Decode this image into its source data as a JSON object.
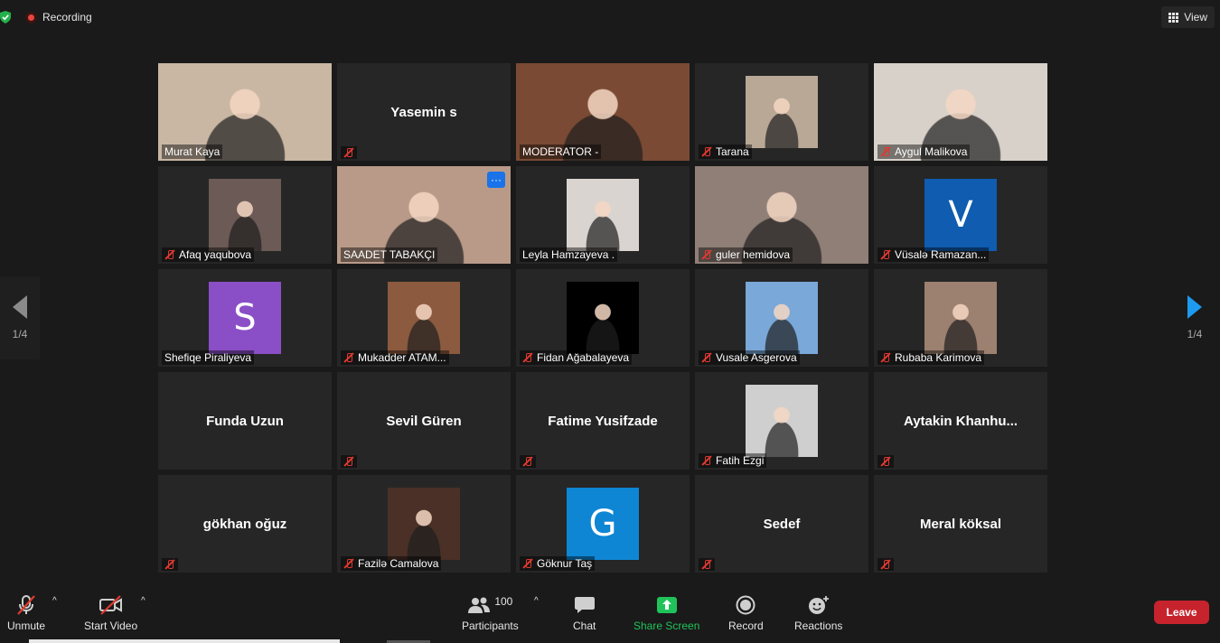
{
  "topbar": {
    "recording_label": "Recording",
    "view_label": "View"
  },
  "pager": {
    "left_label": "1/4",
    "right_label": "1/4"
  },
  "tiles": [
    {
      "name": "Murat Kaya",
      "muted": false,
      "kind": "photo",
      "bg": "#c9b7a4"
    },
    {
      "name": "Yasemin s",
      "muted": true,
      "kind": "name"
    },
    {
      "name": "MODERATOR -",
      "muted": false,
      "kind": "photo",
      "bg": "#7a4a34"
    },
    {
      "name": "Tarana",
      "muted": true,
      "kind": "photo",
      "bg": "#b8a895"
    },
    {
      "name": "Aygul Malikova",
      "muted": true,
      "kind": "photo",
      "bg": "#d7d1c9"
    },
    {
      "name": "Afaq yaqubova",
      "muted": true,
      "kind": "photo",
      "bg": "#6b5a55"
    },
    {
      "name": "SAADET TABAKÇI",
      "muted": false,
      "kind": "photo",
      "bg": "#b99a88",
      "active": true
    },
    {
      "name": "Leyla Hamzayeva .",
      "muted": false,
      "kind": "photo",
      "bg": "#d9d4cf"
    },
    {
      "name": "guler hemidova",
      "muted": true,
      "kind": "photo",
      "bg": "#8f7f77"
    },
    {
      "name": "Vüsalə Ramazan...",
      "muted": true,
      "kind": "letter",
      "letter": "V",
      "color": "#0f5cb0"
    },
    {
      "name": "Shefiqe Piraliyeva",
      "muted": false,
      "kind": "letter",
      "letter": "S",
      "color": "#8a4fc6"
    },
    {
      "name": "Mukadder ATAM...",
      "muted": true,
      "kind": "photo",
      "bg": "#8c5a3e"
    },
    {
      "name": "Fidan Ağabalayeva",
      "muted": true,
      "kind": "photo",
      "bg": "#000000"
    },
    {
      "name": "Vusale Asgerova",
      "muted": true,
      "kind": "photo",
      "bg": "#7aa8d8"
    },
    {
      "name": "Rubaba Karimova",
      "muted": true,
      "kind": "photo",
      "bg": "#9c8070"
    },
    {
      "name": "Funda Uzun",
      "muted": false,
      "kind": "name"
    },
    {
      "name": "Sevil Güren",
      "muted": true,
      "kind": "name"
    },
    {
      "name": "Fatime Yusifzade",
      "muted": true,
      "kind": "name"
    },
    {
      "name": "Fatih Ezgi",
      "muted": true,
      "kind": "photo",
      "bg": "#cfcfcf"
    },
    {
      "name": "Aytakin  Khanhu...",
      "muted": true,
      "kind": "name"
    },
    {
      "name": "gökhan oğuz",
      "muted": true,
      "kind": "name"
    },
    {
      "name": "Fazilə Camalova",
      "muted": true,
      "kind": "photo",
      "bg": "#4a3026"
    },
    {
      "name": "Göknur Taş",
      "muted": true,
      "kind": "letter",
      "letter": "G",
      "color": "#0e86d4"
    },
    {
      "name": "Sedef",
      "muted": true,
      "kind": "name"
    },
    {
      "name": "Meral köksal",
      "muted": true,
      "kind": "name"
    }
  ],
  "toolbar": {
    "unmute": "Unmute",
    "start_video": "Start Video",
    "participants": "Participants",
    "participants_count": "100",
    "chat": "Chat",
    "share_screen": "Share Screen",
    "record": "Record",
    "reactions": "Reactions",
    "leave": "Leave"
  },
  "colors": {
    "accent_blue": "#1d9bf0",
    "active_border": "#d7e76a",
    "share_green": "#1fc35a",
    "leave_red": "#c6232d"
  }
}
